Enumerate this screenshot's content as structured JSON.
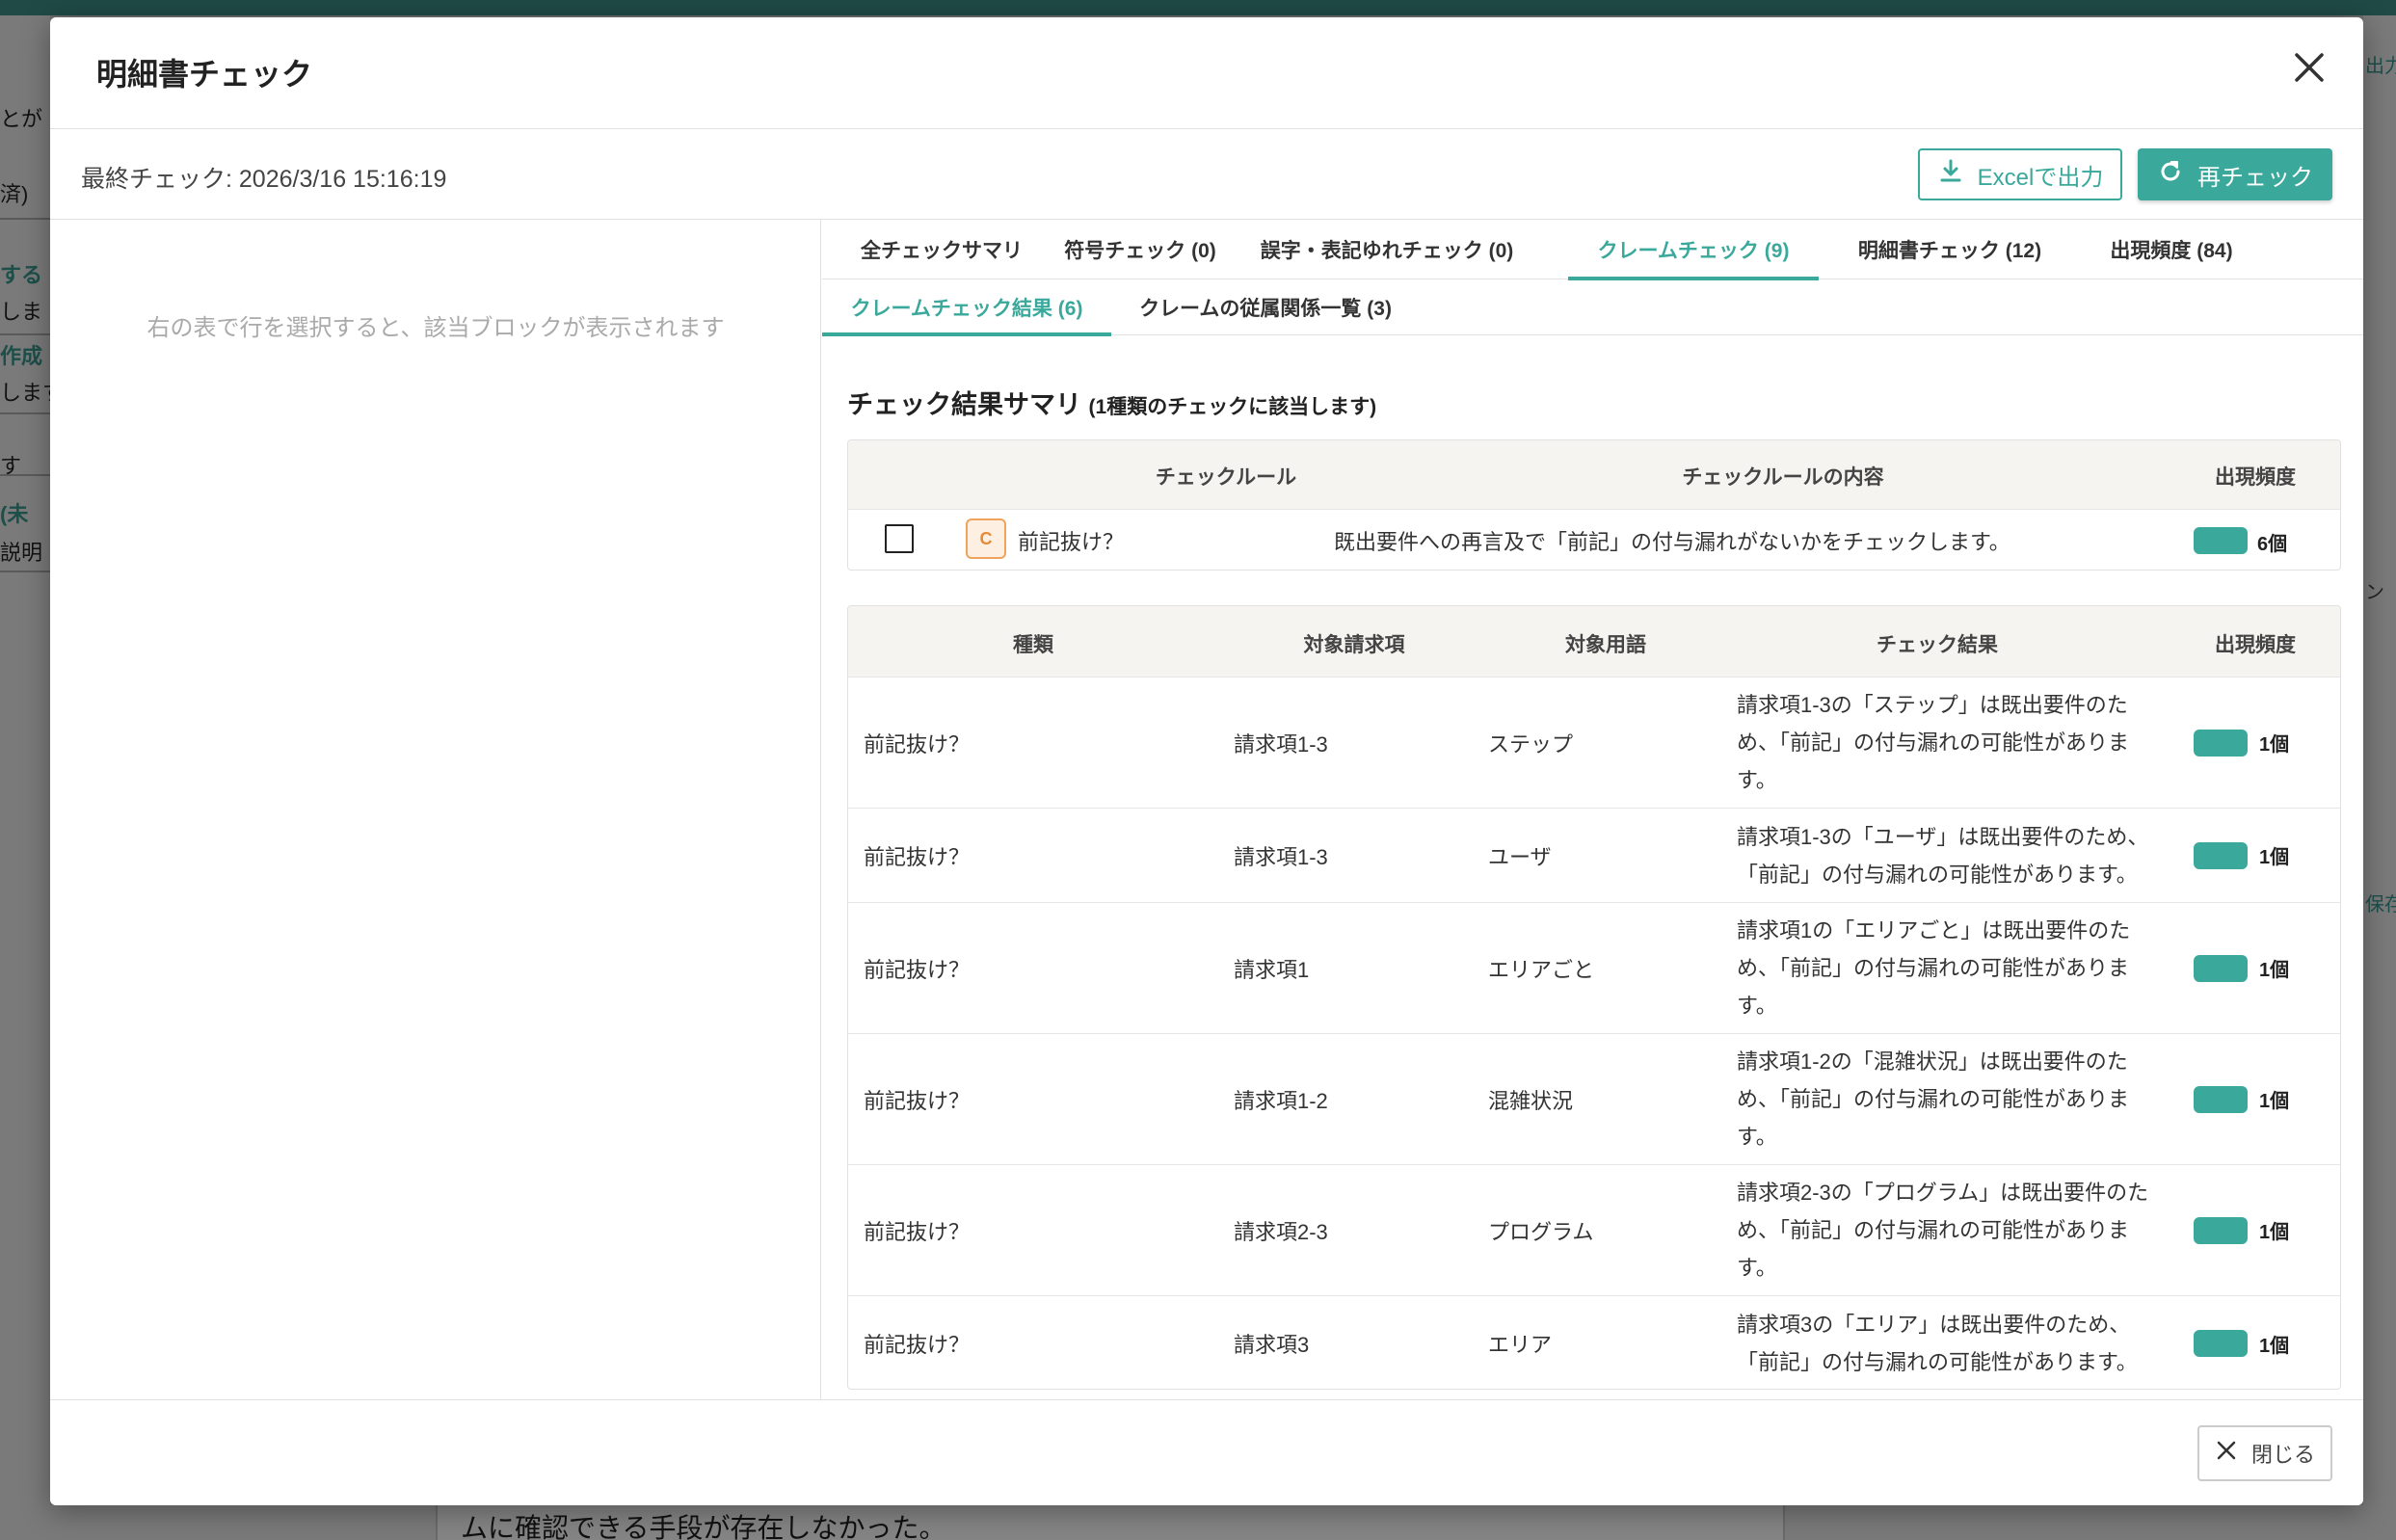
{
  "background": {
    "left_fragments": [
      {
        "text": "とが",
        "teal": false
      },
      {
        "text": "済)",
        "teal": false
      },
      {
        "text": "する",
        "teal": true
      },
      {
        "text": "しま",
        "teal": false
      },
      {
        "text": "作成",
        "teal": true
      },
      {
        "text": "します",
        "teal": false
      },
      {
        "text": "す",
        "teal": false
      },
      {
        "text": "(未",
        "teal": true
      },
      {
        "text": "説明",
        "teal": false
      }
    ],
    "right_fragments": [
      "出力",
      "ン",
      "保存"
    ],
    "bottom_text": "ムに確認できる手段が存在しなかった。"
  },
  "modal": {
    "title": "明細書チェック",
    "last_check": "最終チェック: 2026/3/16 15:16:19",
    "excel_button": "Excelで出力",
    "recheck_button": "再チェック",
    "left_hint": "右の表で行を選択すると、該当ブロックが表示されます",
    "close_button": "閉じる"
  },
  "tabs": [
    {
      "label": "全チェックサマリ",
      "active": false
    },
    {
      "label": "符号チェック (0)",
      "active": false
    },
    {
      "label": "誤字・表記ゆれチェック (0)",
      "active": false
    },
    {
      "label": "クレームチェック (9)",
      "active": true
    },
    {
      "label": "明細書チェック (12)",
      "active": false
    },
    {
      "label": "出現頻度 (84)",
      "active": false
    }
  ],
  "subtabs": [
    {
      "label": "クレームチェック結果 (6)",
      "active": true
    },
    {
      "label": "クレームの従属関係一覧 (3)",
      "active": false
    }
  ],
  "summary": {
    "title": "チェック結果サマリ",
    "subtitle": "(1種類のチェックに該当します)",
    "headers": {
      "rule": "チェックルール",
      "content": "チェックルールの内容",
      "freq": "出現頻度"
    },
    "rows": [
      {
        "badge": "C",
        "rule": "前記抜け？",
        "content": "既出要件への再言及で「前記」の付与漏れがないかをチェックします。",
        "freq": "6個"
      }
    ]
  },
  "results": {
    "headers": {
      "type": "種類",
      "claim": "対象請求項",
      "term": "対象用語",
      "result": "チェック結果",
      "freq": "出現頻度"
    },
    "rows": [
      {
        "type": "前記抜け？",
        "claim": "請求項1-3",
        "term": "ステップ",
        "result": "請求項1-3の「ステップ」は既出要件のため、「前記」の付与漏れの可能性があります。",
        "freq": "1個"
      },
      {
        "type": "前記抜け？",
        "claim": "請求項1-3",
        "term": "ユーザ",
        "result": "請求項1-3の「ユーザ」は既出要件のため、「前記」の付与漏れの可能性があります。",
        "freq": "1個"
      },
      {
        "type": "前記抜け？",
        "claim": "請求項1",
        "term": "エリアごと",
        "result": "請求項1の「エリアごと」は既出要件のため、「前記」の付与漏れの可能性があります。",
        "freq": "1個"
      },
      {
        "type": "前記抜け？",
        "claim": "請求項1-2",
        "term": "混雑状況",
        "result": "請求項1-2の「混雑状況」は既出要件のため、「前記」の付与漏れの可能性があります。",
        "freq": "1個"
      },
      {
        "type": "前記抜け？",
        "claim": "請求項2-3",
        "term": "プログラム",
        "result": "請求項2-3の「プログラム」は既出要件のため、「前記」の付与漏れの可能性があります。",
        "freq": "1個"
      },
      {
        "type": "前記抜け？",
        "claim": "請求項3",
        "term": "エリア",
        "result": "請求項3の「エリア」は既出要件のため、「前記」の付与漏れの可能性があります。",
        "freq": "1個"
      }
    ]
  },
  "colors": {
    "accent": "#3aa99b",
    "badge_border": "#f0a35c",
    "badge_fill": "#fdf0e2"
  },
  "icons": [
    "close-icon",
    "download-icon",
    "refresh-icon",
    "close-small-icon"
  ]
}
